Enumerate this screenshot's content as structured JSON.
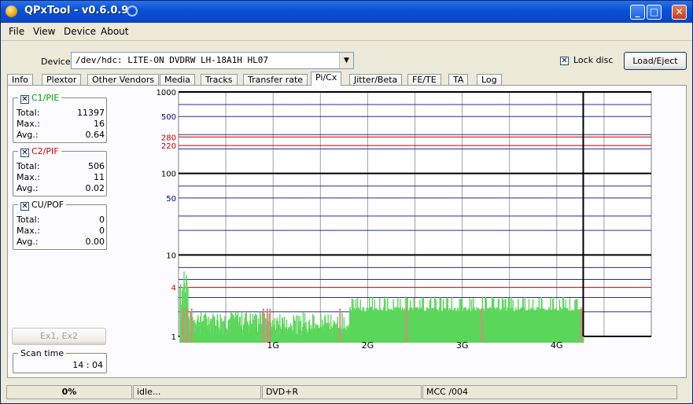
{
  "window": {
    "title": "QPxTool - v0.6.0.9",
    "minimize": "_",
    "maximize": "□",
    "close": "✕"
  },
  "menu": [
    "File",
    "View",
    "Device",
    "About"
  ],
  "device": {
    "label": "Device:",
    "value": "/dev/hdc: LITE-ON  DVDRW LH-18A1H    HL07",
    "lock_label": "Lock disc",
    "lock_checked": true,
    "load_eject": "Load/Eject"
  },
  "tabs": [
    "Info",
    "Plextor",
    "Other Vendors",
    "Media",
    "Tracks",
    "Transfer rate",
    "Pi/Cx",
    "Jitter/Beta",
    "FE/TE",
    "TA",
    "Log"
  ],
  "active_tab": "Pi/Cx",
  "stats": [
    {
      "name": "C1/PIE",
      "color": "#00a000",
      "total": "11397",
      "max": "16",
      "avg": "0.64"
    },
    {
      "name": "C2/PIF",
      "color": "#d00000",
      "total": "506",
      "max": "11",
      "avg": "0.02"
    },
    {
      "name": "CU/POF",
      "color": "#000000",
      "total": "0",
      "max": "0",
      "avg": "0.00"
    }
  ],
  "stat_labels": {
    "total": "Total:",
    "max": "Max.:",
    "avg": "Avg.:"
  },
  "ex_button": "Ex1, Ex2",
  "scan_time": {
    "label": "Scan time",
    "value": "14 : 04"
  },
  "status": {
    "progress": "0%",
    "progress_fraction": 0.0,
    "state": "idle...",
    "media": "DVD+R",
    "mcc": "MCC    /004"
  },
  "chart_data": {
    "type": "bar",
    "y_scale": "log",
    "ylim": [
      1,
      1000
    ],
    "xlim": [
      0,
      5.0
    ],
    "x_ticks": [
      {
        "value": 1,
        "label": "1G"
      },
      {
        "value": 2,
        "label": "2G"
      },
      {
        "value": 3,
        "label": "3G"
      },
      {
        "value": 4,
        "label": "4G"
      }
    ],
    "y_ticks": [
      {
        "value": 1000,
        "label": "1000",
        "color": "#000000"
      },
      {
        "value": 500,
        "label": "500",
        "color": "#000080"
      },
      {
        "value": 280,
        "label": "280",
        "color": "#c00000"
      },
      {
        "value": 220,
        "label": "220",
        "color": "#c00000"
      },
      {
        "value": 100,
        "label": "100",
        "color": "#000000"
      },
      {
        "value": 50,
        "label": "50",
        "color": "#000080"
      },
      {
        "value": 10,
        "label": "10",
        "color": "#000000"
      },
      {
        "value": 4,
        "label": "4",
        "color": "#c00000"
      },
      {
        "value": 1,
        "label": "1",
        "color": "#000000"
      }
    ],
    "end_marker": 4.28,
    "series": [
      {
        "name": "C1/PIE",
        "color": "#5ad65a",
        "values": []
      },
      {
        "name": "C2/PIF",
        "color": "#e88080",
        "values": []
      }
    ]
  }
}
